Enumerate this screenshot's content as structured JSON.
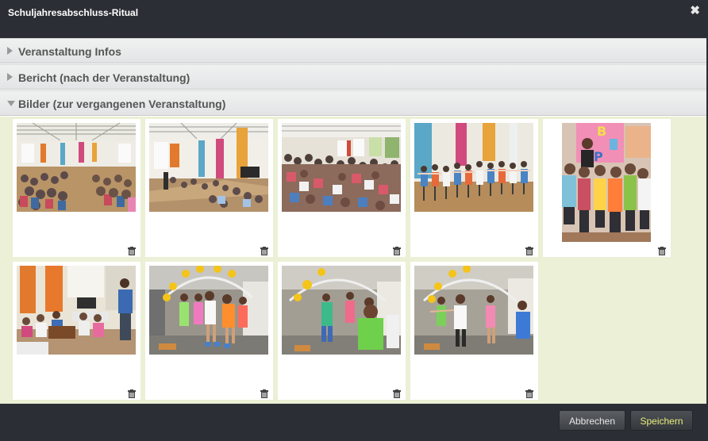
{
  "dialog": {
    "title": "Schuljahresabschluss-Ritual",
    "close_icon": "close-icon"
  },
  "sections": [
    {
      "label": "Veranstaltung Infos",
      "expanded": false
    },
    {
      "label": "Bericht (nach der Veranstaltung)",
      "expanded": false
    },
    {
      "label": "Bilder (zur vergangenen Veranstaltung)",
      "expanded": true
    }
  ],
  "gallery": {
    "photos": [
      {
        "id": "photo-1",
        "scene": "auditorium-crowd"
      },
      {
        "id": "photo-2",
        "scene": "hall-stage"
      },
      {
        "id": "photo-3",
        "scene": "seated-children"
      },
      {
        "id": "photo-4",
        "scene": "children-line"
      },
      {
        "id": "photo-5",
        "scene": "children-portrait"
      },
      {
        "id": "photo-6",
        "scene": "musicians"
      },
      {
        "id": "photo-7",
        "scene": "sunflower-arch"
      },
      {
        "id": "photo-8",
        "scene": "sunflower-arch-boy"
      },
      {
        "id": "photo-9",
        "scene": "sunflower-arch-dance"
      }
    ],
    "delete_icon": "trash-icon"
  },
  "footer": {
    "cancel_label": "Abbrechen",
    "save_label": "Speichern"
  },
  "colors": {
    "chrome": "#2b2f35",
    "gallery_bg": "#ebf0d6",
    "save_text": "#e8ee7a"
  }
}
